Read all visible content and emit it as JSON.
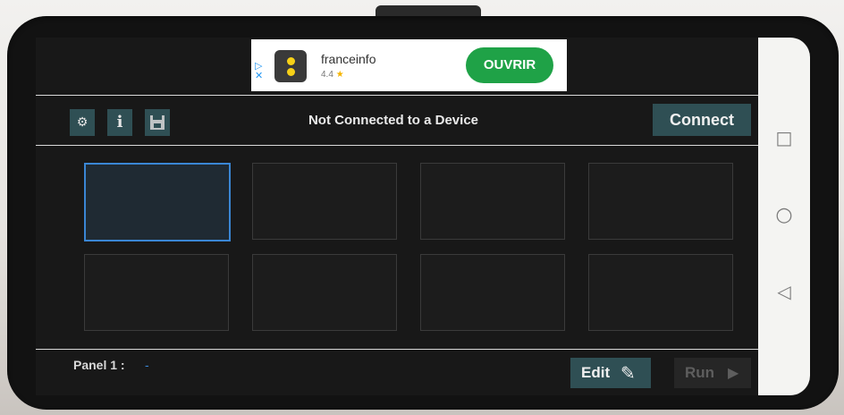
{
  "ad": {
    "choices_icon": "adchoices-icon",
    "app_name": "franceinfo",
    "rating": "4.4",
    "star_icon": "star-icon",
    "cta_label": "OUVRIR",
    "cta_color": "#1fa247"
  },
  "toolbar": {
    "settings_icon": "gears-icon",
    "info_label": "i",
    "save_icon": "floppy-disk-icon",
    "status_text": "Not Connected to a Device",
    "connect_label": "Connect"
  },
  "grid": {
    "rows": 2,
    "columns": 4,
    "selected_cell": 1
  },
  "footer": {
    "panel_label": "Panel 1 :",
    "panel_value": "-",
    "edit_label": "Edit",
    "run_label": "Run"
  },
  "android_nav": {
    "recents_icon": "square-icon",
    "home_icon": "circle-icon",
    "back_icon": "triangle-back-icon"
  },
  "colors": {
    "accent_button": "#2f4f54",
    "selection": "#3a86d4",
    "background": "#181818"
  }
}
